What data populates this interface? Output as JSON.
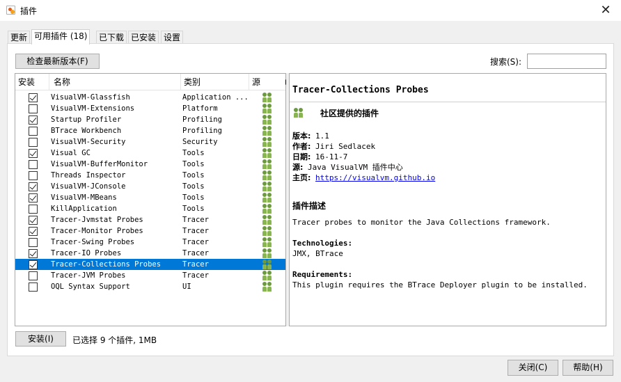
{
  "window": {
    "title": "插件",
    "close_glyph": "✕"
  },
  "tabs": [
    {
      "label": "更新"
    },
    {
      "label": "可用插件 (18)"
    },
    {
      "label": "已下载"
    },
    {
      "label": "已安装"
    },
    {
      "label": "设置"
    }
  ],
  "toolbar": {
    "check_latest_label": "检查最新版本(F)"
  },
  "search": {
    "label": "搜索(S):",
    "value": ""
  },
  "table": {
    "headers": {
      "install": "安装",
      "name": "名称",
      "category": "类别",
      "source": "源"
    },
    "rows": [
      {
        "checked": true,
        "name": "VisualVM-Glassfish",
        "category": "Application ...",
        "selected": false
      },
      {
        "checked": false,
        "name": "VisualVM-Extensions",
        "category": "Platform",
        "selected": false
      },
      {
        "checked": true,
        "name": "Startup Profiler",
        "category": "Profiling",
        "selected": false
      },
      {
        "checked": false,
        "name": "BTrace Workbench",
        "category": "Profiling",
        "selected": false
      },
      {
        "checked": false,
        "name": "VisualVM-Security",
        "category": "Security",
        "selected": false
      },
      {
        "checked": true,
        "name": "Visual GC",
        "category": "Tools",
        "selected": false
      },
      {
        "checked": false,
        "name": "VisualVM-BufferMonitor",
        "category": "Tools",
        "selected": false
      },
      {
        "checked": false,
        "name": "Threads Inspector",
        "category": "Tools",
        "selected": false
      },
      {
        "checked": true,
        "name": "VisualVM-JConsole",
        "category": "Tools",
        "selected": false
      },
      {
        "checked": true,
        "name": "VisualVM-MBeans",
        "category": "Tools",
        "selected": false
      },
      {
        "checked": false,
        "name": "KillApplication",
        "category": "Tools",
        "selected": false
      },
      {
        "checked": true,
        "name": "Tracer-Jvmstat Probes",
        "category": "Tracer",
        "selected": false
      },
      {
        "checked": true,
        "name": "Tracer-Monitor Probes",
        "category": "Tracer",
        "selected": false
      },
      {
        "checked": false,
        "name": "Tracer-Swing Probes",
        "category": "Tracer",
        "selected": false
      },
      {
        "checked": true,
        "name": "Tracer-IO Probes",
        "category": "Tracer",
        "selected": false
      },
      {
        "checked": true,
        "name": "Tracer-Collections Probes",
        "category": "Tracer",
        "selected": true
      },
      {
        "checked": false,
        "name": "Tracer-JVM Probes",
        "category": "Tracer",
        "selected": false
      },
      {
        "checked": false,
        "name": "OQL Syntax Support",
        "category": "UI",
        "selected": false
      }
    ]
  },
  "detail": {
    "title": "Tracer-Collections Probes",
    "community_label": "社区提供的插件",
    "version_key": "版本:",
    "version_val": "1.1",
    "author_key": "作者:",
    "author_val": "Jiri Sedlacek",
    "date_key": "日期:",
    "date_val": "16-11-7",
    "source_key": "源:",
    "source_val": "Java VisualVM 插件中心",
    "homepage_key": "主页:",
    "homepage_val": "https://visualvm.github.io",
    "desc_heading": "插件描述",
    "desc_text": "Tracer probes to monitor the Java Collections framework.",
    "tech_heading": "Technologies:",
    "tech_text": "JMX, BTrace",
    "req_heading": "Requirements:",
    "req_text": "This plugin requires the BTrace Deployer plugin to be installed."
  },
  "footer": {
    "install_label": "安装(I)",
    "status": "已选择 9 个插件, 1MB",
    "close_label": "关闭(C)",
    "help_label": "帮助(H)"
  },
  "colors": {
    "selection": "#0078d7",
    "link": "#0000ee",
    "community_icon": "#88b552"
  },
  "icons": {
    "source_column": "community-people-icon",
    "checkbox": "checkbox"
  }
}
